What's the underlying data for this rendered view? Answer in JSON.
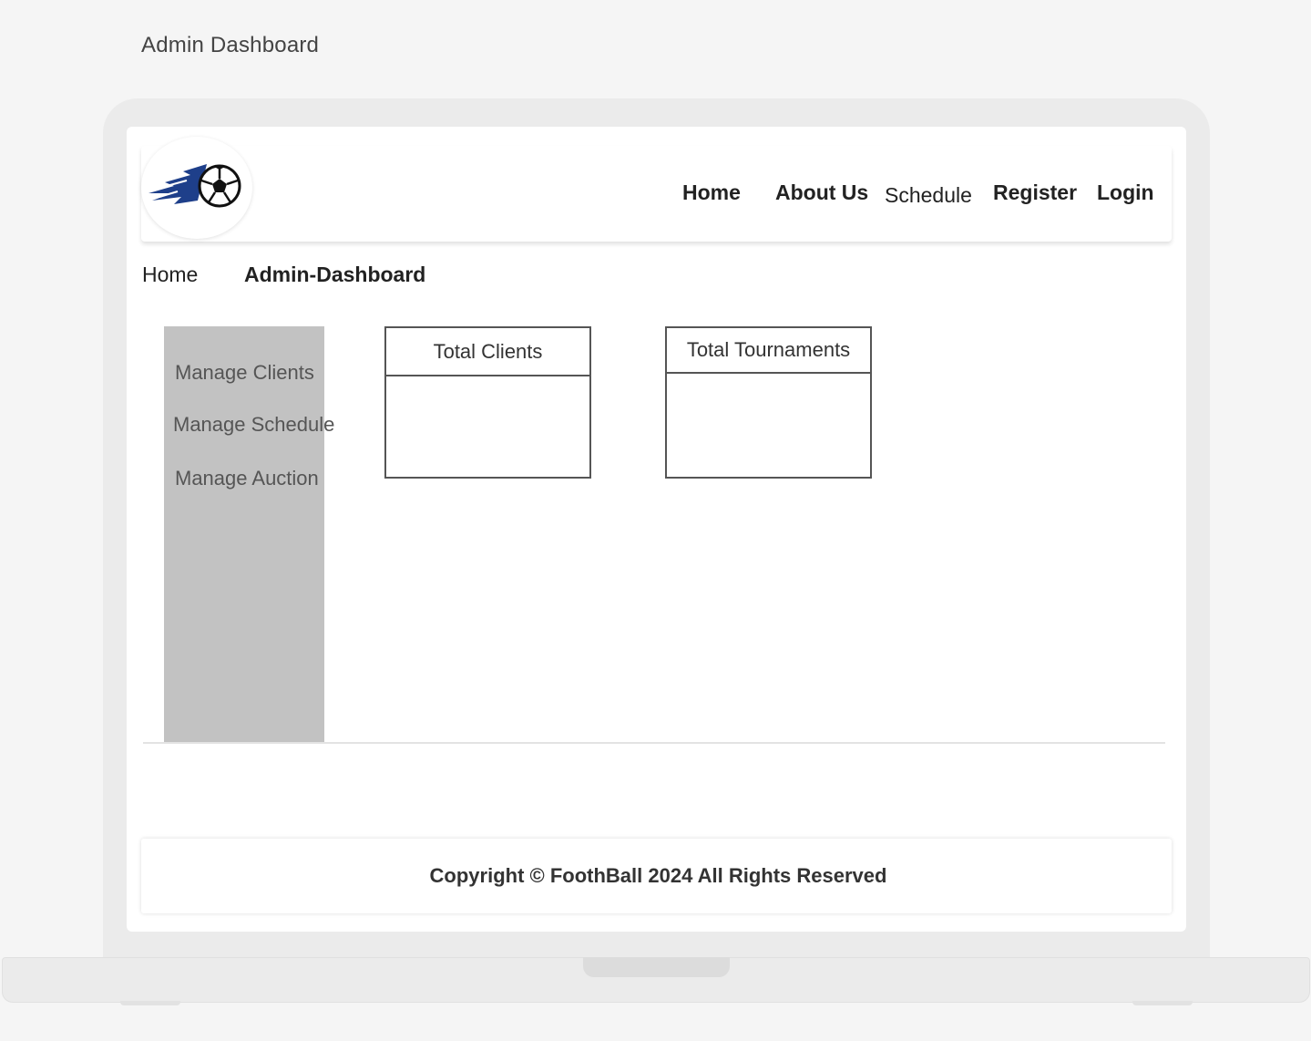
{
  "frame_title": "Admin Dashboard",
  "logo": {
    "icon": "soccer-ball-flame-icon",
    "color": "#1e3f8a"
  },
  "nav": {
    "links": [
      "Home",
      "About Us",
      "Schedule",
      "Register",
      "Login"
    ]
  },
  "breadcrumb": {
    "home": "Home",
    "current": "Admin-Dashboard"
  },
  "sidebar": {
    "items": [
      "Manage Clients",
      "Manage Schedule",
      "Manage Auction"
    ],
    "background": "#c2c2c2"
  },
  "cards": [
    {
      "title": "Total Clients"
    },
    {
      "title": "Total Tournaments"
    }
  ],
  "footer": {
    "text": "Copyright © FoothBall 2024 All Rights Reserved"
  }
}
